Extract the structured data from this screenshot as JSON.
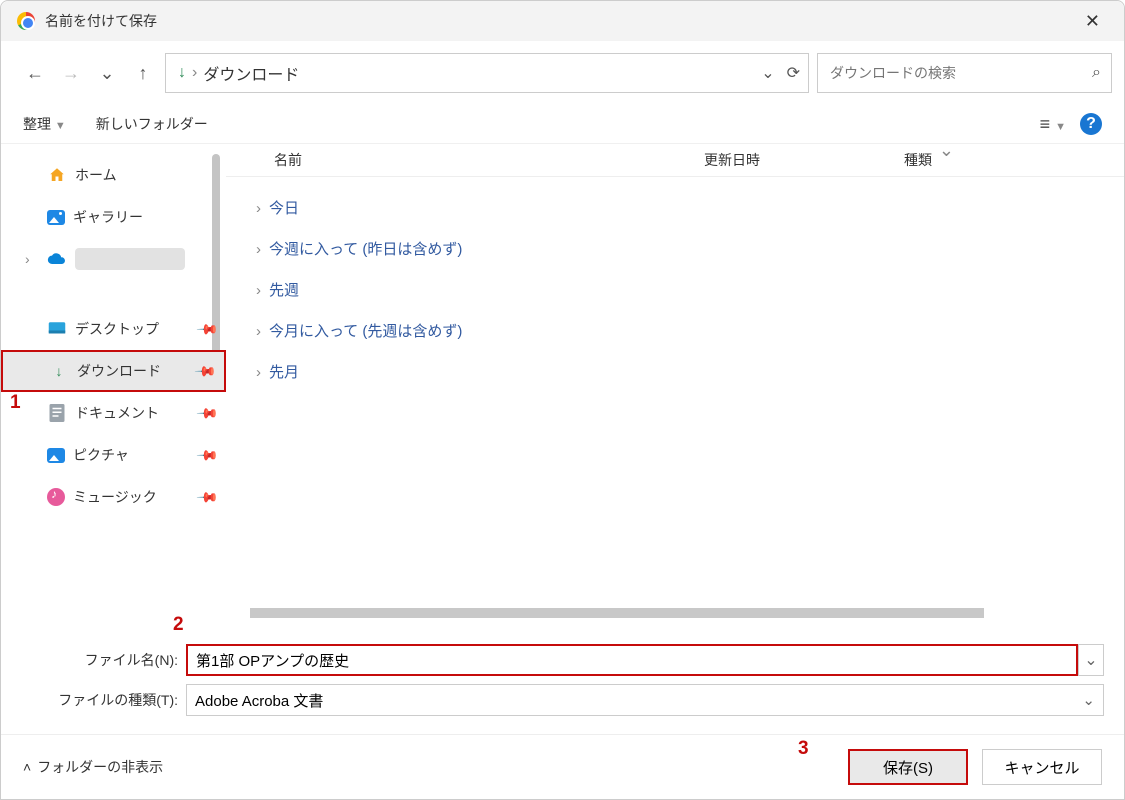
{
  "titlebar": {
    "title": "名前を付けて保存"
  },
  "addressbar": {
    "location": "ダウンロード"
  },
  "search": {
    "placeholder": "ダウンロードの検索"
  },
  "toolbar": {
    "organize": "整理",
    "new_folder": "新しいフォルダー"
  },
  "sidebar": {
    "home": "ホーム",
    "gallery": "ギャラリー",
    "desktop": "デスクトップ",
    "downloads": "ダウンロード",
    "documents": "ドキュメント",
    "pictures": "ピクチャ",
    "music": "ミュージック"
  },
  "columns": {
    "name": "名前",
    "date": "更新日時",
    "type": "種類"
  },
  "groups": {
    "today": "今日",
    "this_week": "今週に入って (昨日は含めず)",
    "last_week": "先週",
    "this_month": "今月に入って (先週は含めず)",
    "last_month": "先月"
  },
  "footer": {
    "filename_label": "ファイル名(N):",
    "filename_value": "第1部 OPアンプの歴史",
    "filetype_label": "ファイルの種類(T):",
    "filetype_value": "Adobe Acroba 文書"
  },
  "bottombar": {
    "hide_folders": "フォルダーの非表示",
    "save": "保存(S)",
    "cancel": "キャンセル"
  },
  "annotations": {
    "one": "1",
    "two": "2",
    "three": "3"
  }
}
